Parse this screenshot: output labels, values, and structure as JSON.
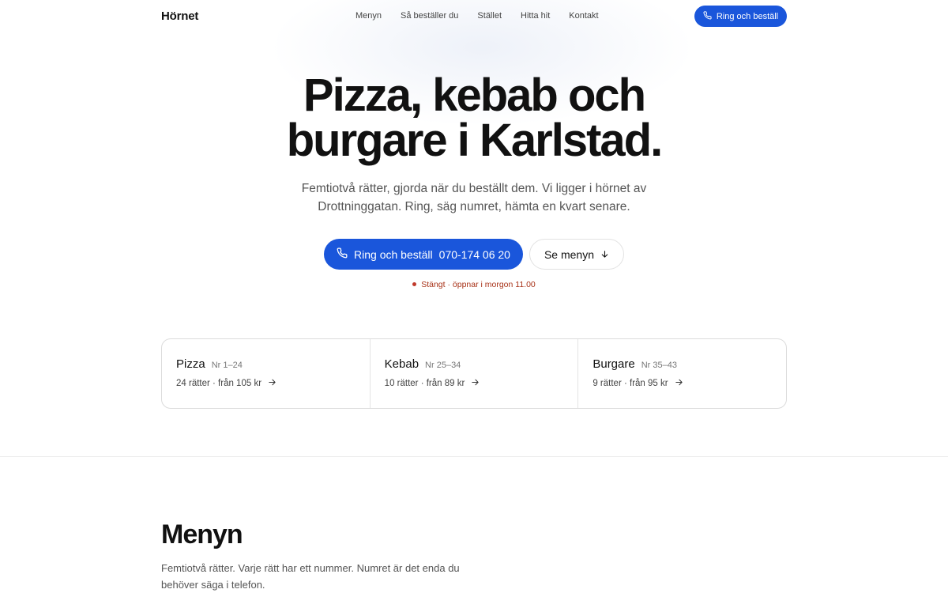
{
  "brand": {
    "name": "Hörnet",
    "accent": "#1a56db",
    "status_color": "#a83218"
  },
  "nav": {
    "items": [
      {
        "label": "Menyn"
      },
      {
        "label": "Så beställer du"
      },
      {
        "label": "Stället"
      },
      {
        "label": "Hitta hit"
      },
      {
        "label": "Kontakt"
      }
    ],
    "cta_label": "Ring och beställ",
    "cta_icon": "phone-icon"
  },
  "hero": {
    "title_line1": "Pizza, kebab och",
    "title_line2": "burgare i Karlstad.",
    "subtitle": "Femtiotvå rätter, gjorda när du beställt dem. Vi ligger i hörnet av Drottninggatan. Ring, säg numret, hämta en kvart senare.",
    "primary_label": "Ring och beställ",
    "primary_phone": "070-174 06 20",
    "secondary_label": "Se menyn",
    "secondary_icon": "arrow-down-icon",
    "status": "Stängt · öppnar i morgon 11.00"
  },
  "categories": [
    {
      "name": "Pizza",
      "range": "Nr 1–24",
      "info": "24 rätter · från 105 kr"
    },
    {
      "name": "Kebab",
      "range": "Nr 25–34",
      "info": "10 rätter · från 89 kr"
    },
    {
      "name": "Burgare",
      "range": "Nr 35–43",
      "info": "9 rätter · från 95 kr"
    }
  ],
  "menu_section": {
    "title": "Menyn",
    "text": "Femtiotvå rätter. Varje rätt har ett nummer. Numret är det enda du behöver säga i telefon."
  }
}
